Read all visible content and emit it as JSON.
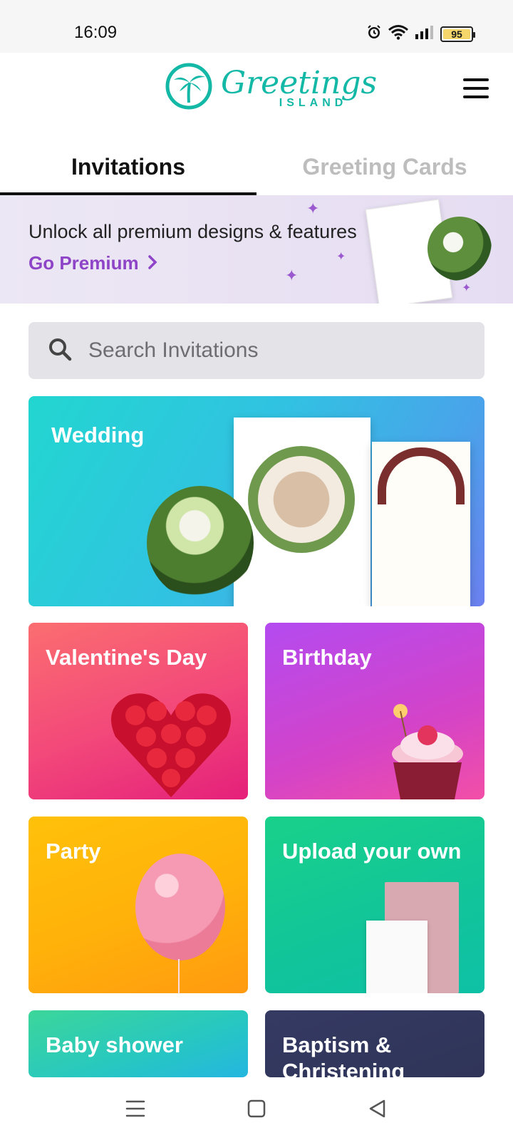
{
  "status_bar": {
    "time": "16:09",
    "battery": "95"
  },
  "header": {
    "logo_main": "Greetings",
    "logo_sub": "ISLAND",
    "menu_icon": "hamburger-menu-icon"
  },
  "tabs": [
    {
      "label": "Invitations",
      "active": true
    },
    {
      "label": "Greeting Cards",
      "active": false
    }
  ],
  "promo": {
    "text": "Unlock all premium designs & features",
    "cta": "Go Premium",
    "cta_color": "#8e44c7"
  },
  "search": {
    "placeholder": "Search Invitations"
  },
  "categories": [
    {
      "label": "Wedding"
    },
    {
      "label": "Valentine's Day"
    },
    {
      "label": "Birthday"
    },
    {
      "label": "Party"
    },
    {
      "label": "Upload your own"
    },
    {
      "label": "Baby shower"
    },
    {
      "label": "Baptism & Christening"
    }
  ],
  "brand_color": "#14b8a6"
}
